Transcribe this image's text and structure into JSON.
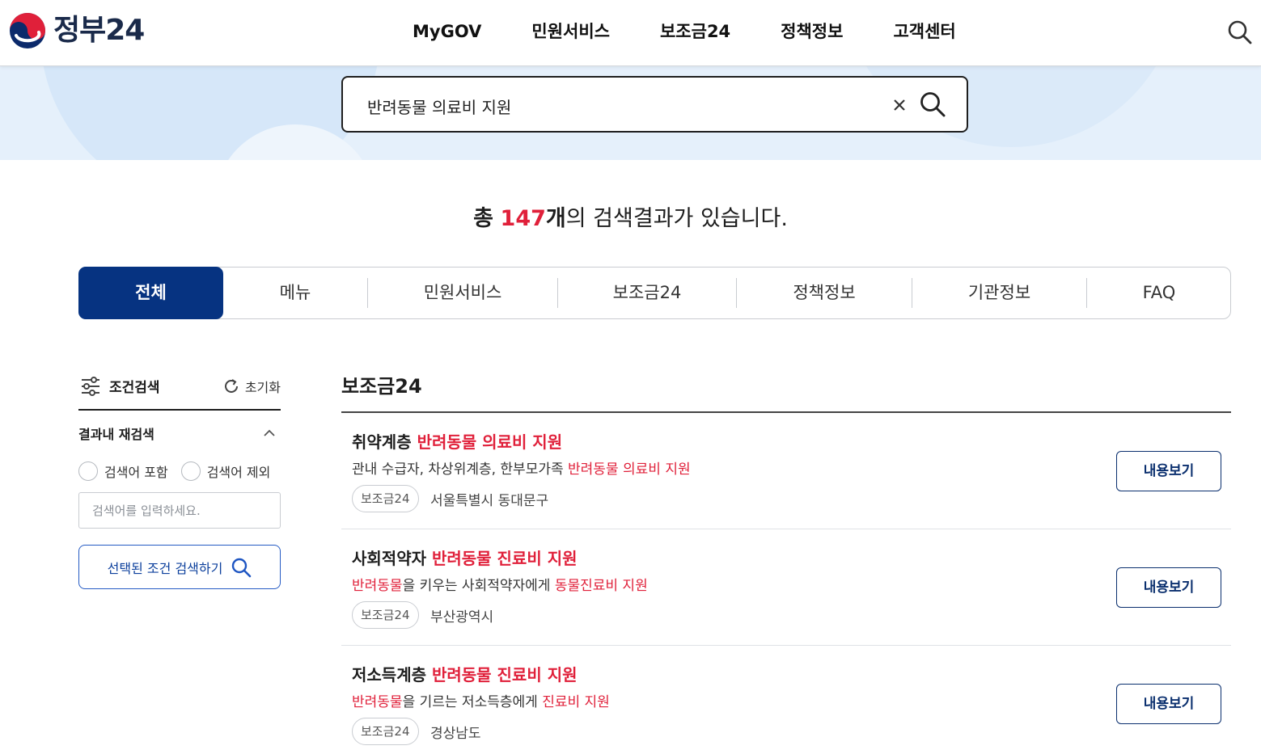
{
  "header": {
    "logo_text": "정부24",
    "nav": [
      "MyGOV",
      "민원서비스",
      "보조금24",
      "정책정보",
      "고객센터"
    ]
  },
  "search": {
    "query": "반려동물 의료비 지원"
  },
  "summary": {
    "prefix": "총",
    "count": "147",
    "unit": "개",
    "suffix": "의 검색결과가 있습니다."
  },
  "tabs": [
    "전체",
    "메뉴",
    "민원서비스",
    "보조금24",
    "정책정보",
    "기관정보",
    "FAQ"
  ],
  "active_tab": "전체",
  "sidebar": {
    "title": "조건검색",
    "reset_label": "초기화",
    "refine_title": "결과내 재검색",
    "radio_include": "검색어 포함",
    "radio_exclude": "검색어 제외",
    "input_placeholder": "검색어를 입력하세요.",
    "submit_label": "선택된 조건 검색하기"
  },
  "results_section": {
    "title": "보조금24",
    "view_label": "내용보기",
    "items": [
      {
        "title_plain": "취약계층 ",
        "title_hl": "반려동물 의료비 지원",
        "desc": [
          {
            "t": "관내 수급자, 차상위계층, 한부모가족 ",
            "hl": false
          },
          {
            "t": "반려동물 의료비 지원",
            "hl": true
          }
        ],
        "badge": "보조금24",
        "region": "서울특별시 동대문구"
      },
      {
        "title_plain": "사회적약자 ",
        "title_hl": "반려동물 진료비 지원",
        "desc": [
          {
            "t": "반려동물",
            "hl": true
          },
          {
            "t": "을 키우는 사회적약자에게 ",
            "hl": false
          },
          {
            "t": "동물진료비 지원",
            "hl": true
          }
        ],
        "badge": "보조금24",
        "region": "부산광역시"
      },
      {
        "title_plain": "저소득계층 ",
        "title_hl": "반려동물 진료비 지원",
        "desc": [
          {
            "t": "반려동물",
            "hl": true
          },
          {
            "t": "을 기르는 저소득층에게 ",
            "hl": false
          },
          {
            "t": "진료비 지원",
            "hl": true
          }
        ],
        "badge": "보조금24",
        "region": "경상남도"
      }
    ]
  },
  "colors": {
    "brand_navy": "#063381",
    "highlight_red": "#e0203a",
    "banner_bg": "#e5f0fb"
  }
}
